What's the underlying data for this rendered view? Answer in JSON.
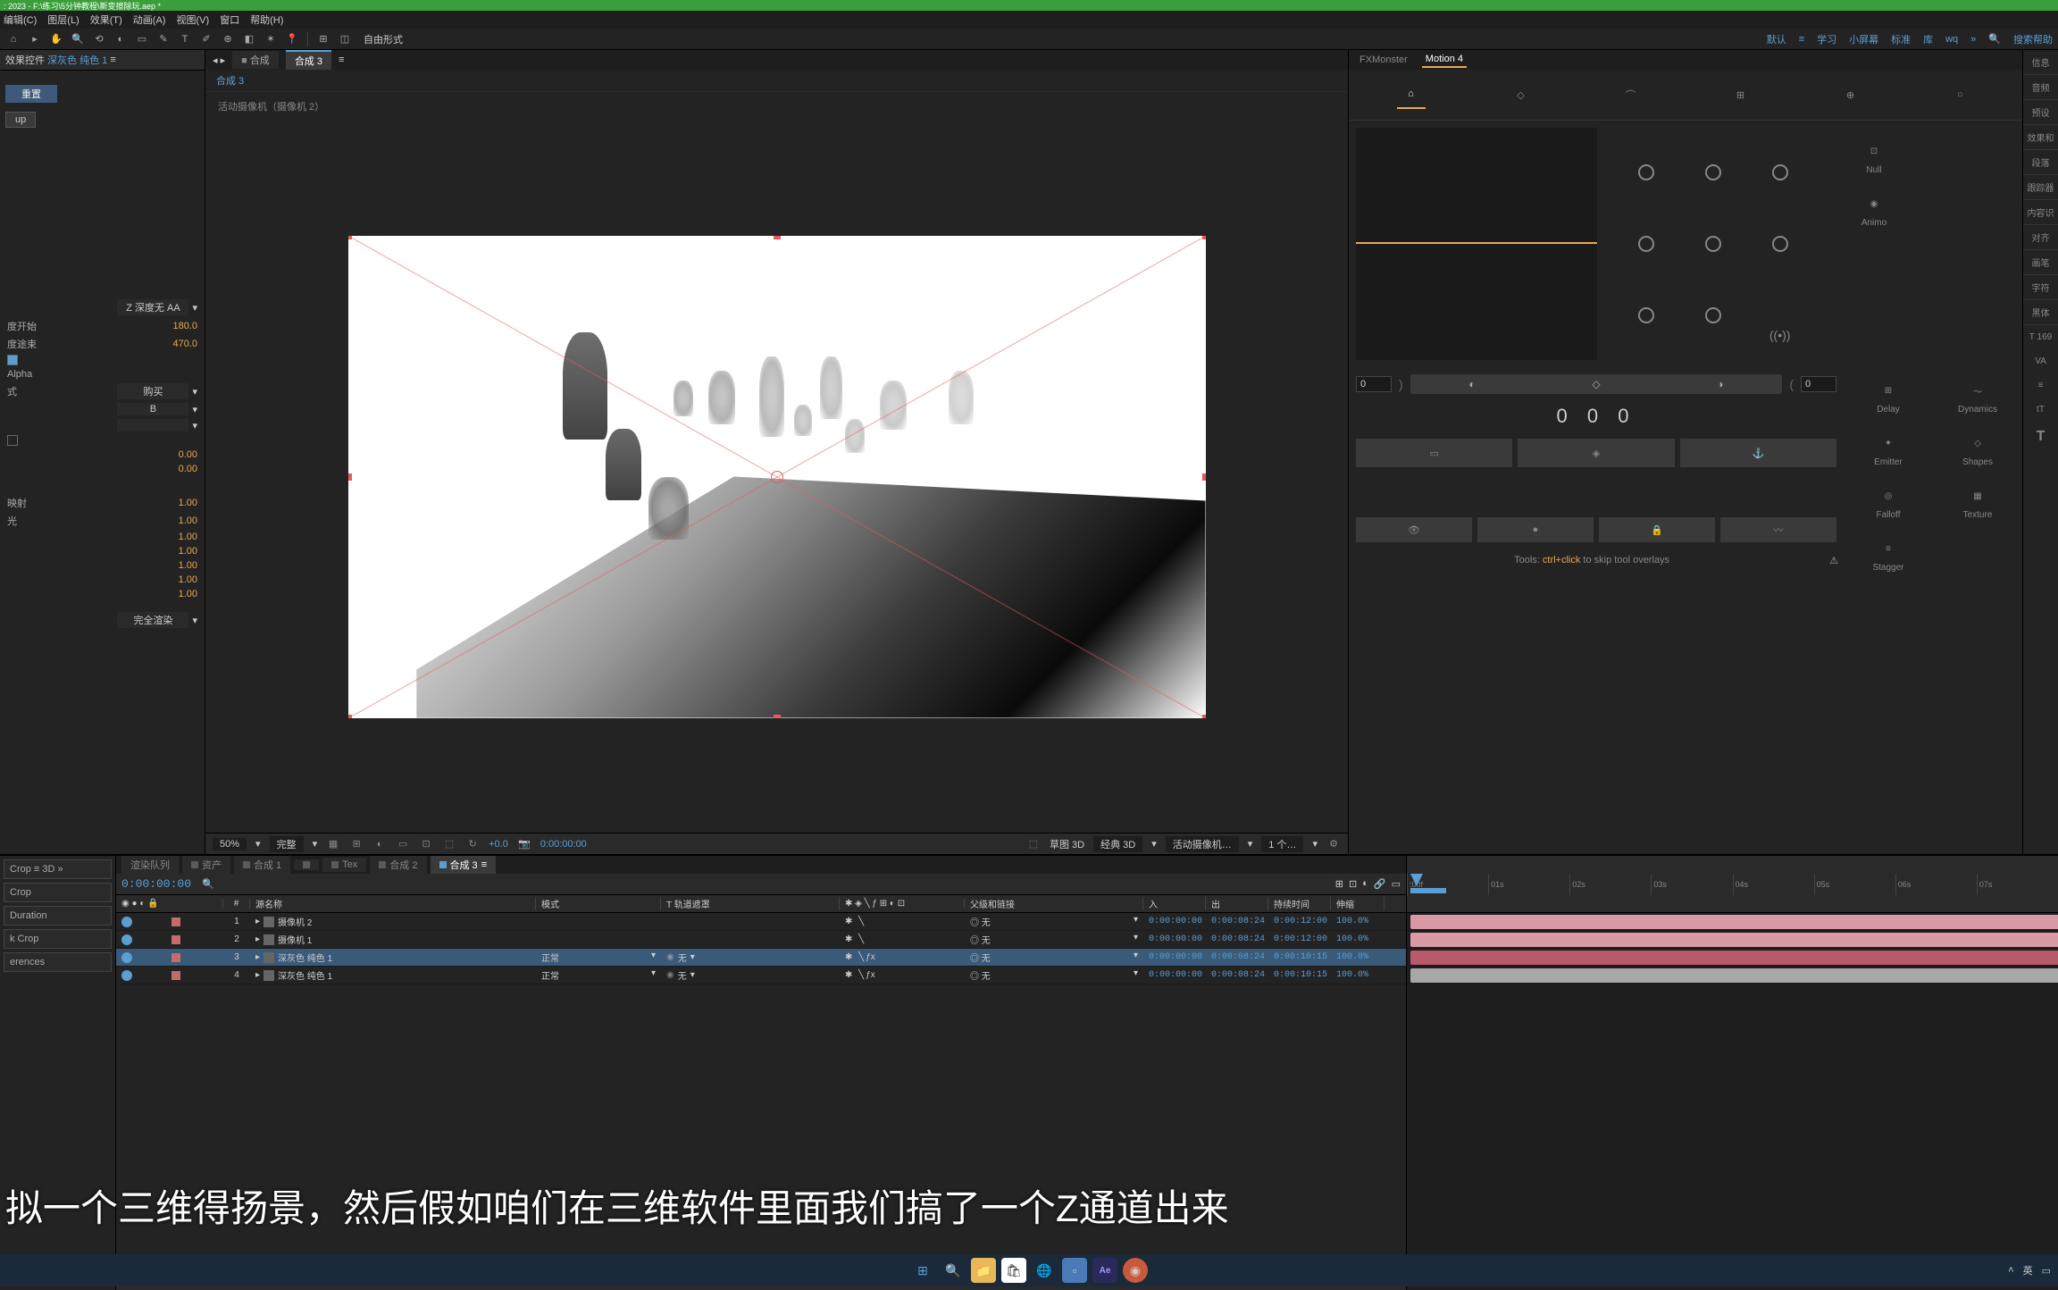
{
  "titlebar": {
    "text": ": 2023 - F:\\练习\\5分钟教程\\新变擦除玩.aep *"
  },
  "menubar": {
    "items": [
      "编辑(C)",
      "图层(L)",
      "效果(T)",
      "动画(A)",
      "视图(V)",
      "窗口",
      "帮助(H)"
    ]
  },
  "toolbar": {
    "freeform": "自由形式",
    "right": [
      "默认",
      "学习",
      "小屏幕",
      "标准",
      "库",
      "wq"
    ],
    "search": "搜索帮助"
  },
  "effectControls": {
    "panelLabel": "效果控件",
    "panelTarget": "深灰色 纯色 1",
    "subTab": "重置",
    "setupBtn": "up",
    "depthLabel": "Z 深度无 AA",
    "props": [
      {
        "label": "度开始",
        "value": "180.0"
      },
      {
        "label": "度途束",
        "value": "470.0"
      },
      {
        "label": "",
        "value": "",
        "checkbox": true
      },
      {
        "label": "Alpha",
        "value": ""
      },
      {
        "label": "式",
        "select": "购买"
      },
      {
        "label": "",
        "select": "B"
      },
      {
        "label": "",
        "select": ""
      },
      {
        "label": "",
        "checkbox": false
      },
      {
        "label": "",
        "value": "0.00"
      },
      {
        "label": "",
        "value": "0.00"
      }
    ],
    "sectionLabels": [
      "映射",
      "光"
    ],
    "unitProps": [
      "1.00",
      "1.00",
      "1.00",
      "1.00",
      "1.00",
      "1.00",
      "1.00"
    ],
    "renderLabel": "完全渲染"
  },
  "composition": {
    "tabBadge": "合成",
    "activeTab": "合成 3",
    "subtitle": "合成 3",
    "info": "活动摄像机（摄像机 2）"
  },
  "compFooter": {
    "zoom": "50%",
    "quality": "完整",
    "blueVal": "+0.0",
    "timecode": "0:00:00:00",
    "draft": "草图 3D",
    "classic": "经典 3D",
    "camera": "活动摄像机…",
    "views": "1 个…"
  },
  "fxMonster": {
    "tabs": [
      "FXMonster",
      "Motion 4"
    ],
    "activeTab": "Motion 4",
    "tools": [
      {
        "label": "Null"
      },
      {
        "label": "Animo"
      },
      {
        "label": "Delay"
      },
      {
        "label": "Dynamics"
      },
      {
        "label": "Emitter"
      },
      {
        "label": "Shapes"
      },
      {
        "label": "Falloff"
      },
      {
        "label": "Texture"
      },
      {
        "label": "Stagger"
      }
    ],
    "leftVal": "0",
    "rightVal": "0",
    "counter": "0 0 0",
    "hint_prefix": "Tools: ",
    "hint_key": "ctrl+click",
    "hint_suffix": " to skip tool overlays"
  },
  "farRight": {
    "items": [
      "信息",
      "音频",
      "预设",
      "效果和",
      "段落",
      "跟踪器",
      "内容识",
      "对齐",
      "画笔",
      "字符",
      "黑体"
    ],
    "fontNum": "169",
    "tIcon": "T"
  },
  "timeline": {
    "farLeft": [
      "Crop",
      "3D",
      "Crop",
      "Duration",
      "k Crop",
      "erences"
    ],
    "tabs": [
      {
        "label": "渲染队列",
        "active": false
      },
      {
        "label": "资产",
        "active": false
      },
      {
        "label": "合成 1",
        "active": false
      },
      {
        "label": "",
        "active": false
      },
      {
        "label": "Tex",
        "active": false
      },
      {
        "label": "合成 2",
        "active": false
      },
      {
        "label": "合成 3",
        "active": true
      }
    ],
    "timecode": "0:00:00:00",
    "columns": {
      "sourceName": "源名称",
      "mode": "模式",
      "trackMatte": "轨道遮罩",
      "parent": "父级和链接",
      "in": "入",
      "out": "出",
      "duration": "持续时间",
      "stretch": "伸缩"
    },
    "layers": [
      {
        "num": "1",
        "color": "#c76a6a",
        "name": "摄像机 2",
        "mode": "",
        "matte": "",
        "parent": "无",
        "in": "0:00:00:00",
        "out": "0:00:08:24",
        "dur": "0:00:12:00",
        "str": "100.0%",
        "selected": false,
        "barColor": "#d99aa5"
      },
      {
        "num": "2",
        "color": "#c76a6a",
        "name": "摄像机 1",
        "mode": "",
        "matte": "",
        "parent": "无",
        "in": "0:00:00:00",
        "out": "0:00:08:24",
        "dur": "0:00:12:00",
        "str": "100.0%",
        "selected": false,
        "barColor": "#d99aa5"
      },
      {
        "num": "3",
        "color": "#c76a6a",
        "name": "深灰色 纯色 1",
        "mode": "正常",
        "matte": "无",
        "parent": "无",
        "in": "0:00:00:00",
        "out": "0:00:08:24",
        "dur": "0:00:10:15",
        "str": "100.0%",
        "selected": true,
        "barColor": "#b85a6a"
      },
      {
        "num": "4",
        "color": "#c76a6a",
        "name": "深灰色 纯色 1",
        "mode": "正常",
        "matte": "无",
        "parent": "无",
        "in": "0:00:00:00",
        "out": "0:00:08:24",
        "dur": "0:00:10:15",
        "str": "100.0%",
        "selected": false,
        "barColor": "#a8a8a8"
      }
    ],
    "ruler": [
      "01s",
      "02s",
      "03s",
      "04s",
      "05s",
      "06s",
      "07s"
    ]
  },
  "subtitle": "拟一个三维得扬景，然后假如咱们在三维软件里面我们搞了一个Z通道出来",
  "taskbar": {
    "rightText": "英"
  }
}
